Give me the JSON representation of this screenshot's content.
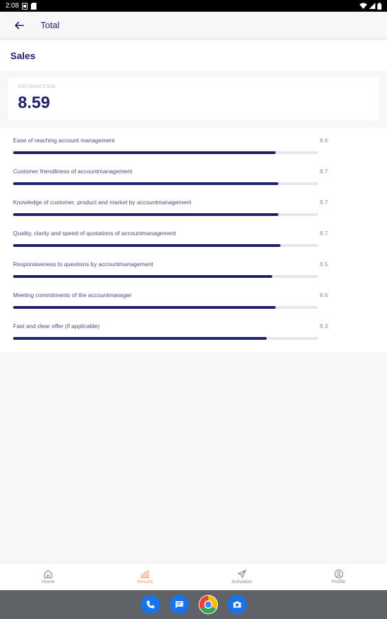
{
  "status_bar": {
    "time": "2:08"
  },
  "app_bar": {
    "title": "Total"
  },
  "section": {
    "title": "Sales"
  },
  "score": {
    "label": "SATISFACTION",
    "value": "8.59"
  },
  "criteria": [
    {
      "label": "Ease of reaching account management",
      "value": "8.6",
      "progress": 0.86
    },
    {
      "label": "Customer friendliness of accountmanagement",
      "value": "8.7",
      "progress": 0.87
    },
    {
      "label": "Knowledge of customer, product and market by accountmanagement",
      "value": "8.7",
      "progress": 0.87
    },
    {
      "label": "Quality, clarity and speed of quotations of accountmanagement",
      "value": "8.7",
      "progress": 0.875
    },
    {
      "label": "Responsiveness to questions by accountmanagement",
      "value": "8.5",
      "progress": 0.85
    },
    {
      "label": "Meeting commitments of the accountmanager",
      "value": "8.6",
      "progress": 0.86
    },
    {
      "label": "Fast and clear offer (if applicable)",
      "value": "8.3",
      "progress": 0.83
    }
  ],
  "nav": [
    {
      "label": "Home",
      "icon": "home-icon",
      "active": false
    },
    {
      "label": "Results",
      "icon": "chart-icon",
      "active": true
    },
    {
      "label": "Activation",
      "icon": "send-icon",
      "active": false
    },
    {
      "label": "Profile",
      "icon": "profile-icon",
      "active": false
    }
  ],
  "dock": [
    {
      "icon": "phone-icon"
    },
    {
      "icon": "messages-icon"
    },
    {
      "icon": "chrome-icon"
    },
    {
      "icon": "camera-icon"
    }
  ],
  "colors": {
    "primary": "#1e1f6b",
    "accent": "#f4a06e",
    "track": "#e6e7ee"
  }
}
